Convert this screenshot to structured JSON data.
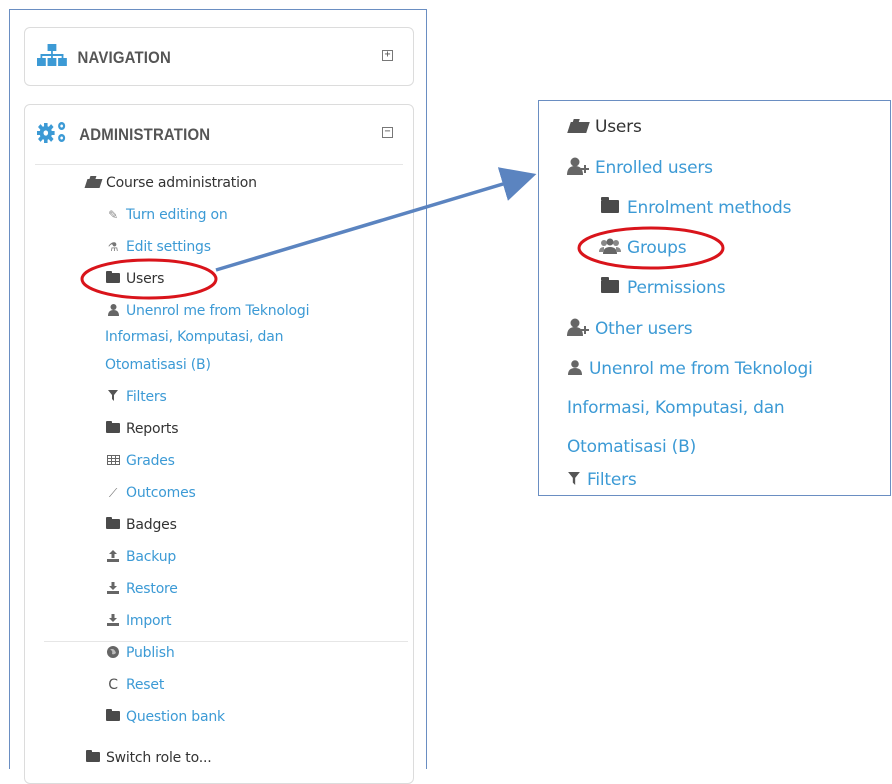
{
  "navigation_block": {
    "title": "NAVIGATION",
    "toggle": "+"
  },
  "administration_block": {
    "title": "ADMINISTRATION",
    "toggle": "−",
    "course_administration": "Course administration",
    "items": {
      "turn_editing_on": "Turn editing on",
      "edit_settings": "Edit settings",
      "users": "Users",
      "unenrol_line1": "Unenrol me from Teknologi",
      "unenrol_line2": "Informasi, Komputasi, dan",
      "unenrol_line3": "Otomatisasi (B)",
      "filters": "Filters",
      "reports": "Reports",
      "grades": "Grades",
      "outcomes": "Outcomes",
      "badges": "Badges",
      "backup": "Backup",
      "restore": "Restore",
      "import": "Import",
      "publish": "Publish",
      "reset": "Reset",
      "question_bank": "Question bank"
    },
    "switch_role": "Switch role to..."
  },
  "zoom_panel": {
    "users": "Users",
    "enrolled_users": "Enrolled users",
    "enrolment_methods": "Enrolment methods",
    "groups": "Groups",
    "permissions": "Permissions",
    "other_users": "Other users",
    "unenrol_line1": "Unenrol me from Teknologi",
    "unenrol_line2": "Informasi, Komputasi, dan",
    "unenrol_line3": "Otomatisasi (B)",
    "filters": "Filters"
  },
  "colors": {
    "link": "#3c9ad5",
    "text": "#333333",
    "frame": "#6a8ec2",
    "highlight": "#d9141b",
    "arrow": "#5b84c0"
  }
}
